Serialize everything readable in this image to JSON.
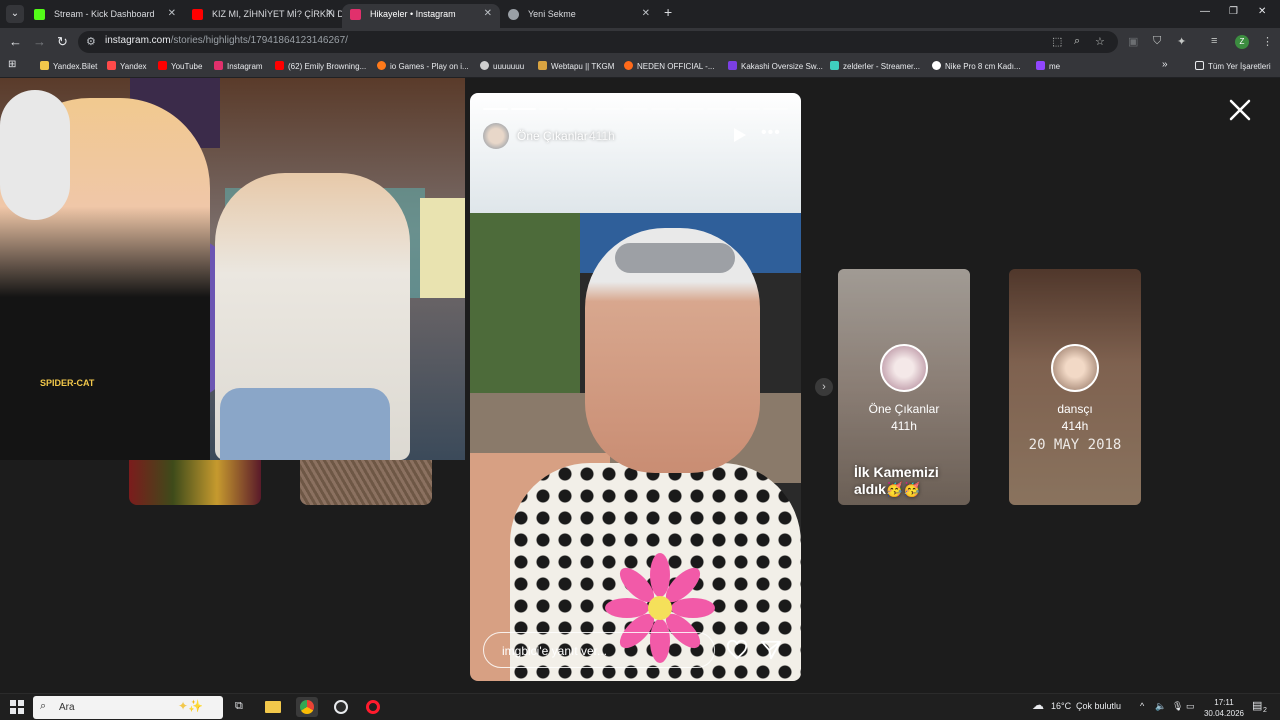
{
  "tabs": [
    {
      "title": "Stream - Kick Dashboard",
      "favicon_color": "#53fc18"
    },
    {
      "title": "KIZ MI, ZİHNİYET Mİ? ÇİRKİN D",
      "favicon_color": "#ff0000"
    },
    {
      "title": "Hikayeler • Instagram",
      "favicon_color": "#e1306c"
    },
    {
      "title": "Yeni Sekme",
      "favicon_color": "#9aa0a6"
    }
  ],
  "address": {
    "domain": "instagram.com",
    "path": "/stories/highlights/17941864123146267/"
  },
  "profile_initial": "Z",
  "bookmarks": [
    {
      "label": "Yandex.Bilet",
      "color": "#f2c84b"
    },
    {
      "label": "Yandex",
      "color": "#ff4a4a"
    },
    {
      "label": "YouTube",
      "color": "#ff0000"
    },
    {
      "label": "Instagram",
      "color": "#e1306c"
    },
    {
      "label": "(62) Emily Browning...",
      "color": "#ff0000"
    },
    {
      "label": "io Games - Play on i...",
      "color": "#ff7a1a"
    },
    {
      "label": "uuuuuuu",
      "color": "#cfcfcf"
    },
    {
      "label": "Webtapu || TKGM",
      "color": "#d9a441"
    },
    {
      "label": "NEDEN OFFICIAL -...",
      "color": "#ff6a1a"
    },
    {
      "label": "Kakashi Oversize Sw...",
      "color": "#7b3fe4"
    },
    {
      "label": "zelderler - Streamer...",
      "color": "#3fd0c0"
    },
    {
      "label": "Nike Pro 8 cm Kadı...",
      "color": "#ffffff"
    },
    {
      "label": "me",
      "color": "#9146ff"
    }
  ],
  "bookmarks_overflow": "»",
  "all_bookmarks": "Tüm Yer İşaretleri",
  "webcam": {
    "shirt_text": "SPIDER-CAT"
  },
  "story": {
    "username": "Öne Çıkanlar",
    "time": "411h",
    "segments_total": 11,
    "segments_done": 2,
    "reply_placeholder": "imgblci'e yanıt ver..."
  },
  "previews": [
    {
      "name": "Öne Çıkanlar",
      "time": "411h",
      "caption": "İlk Kamemizi aldık🥳🥳"
    },
    {
      "name": "dansçı",
      "time": "414h",
      "date": "20 MAY 2018"
    }
  ],
  "taskbar": {
    "search_placeholder": "Ara",
    "weather_temp": "16°C",
    "weather_text": "Çok bulutlu",
    "time": "17:11",
    "date": "30.04.2026",
    "notification_count": "2"
  },
  "colors": {
    "accent": "#0095f6",
    "story_bg": "#1c1c1c"
  }
}
